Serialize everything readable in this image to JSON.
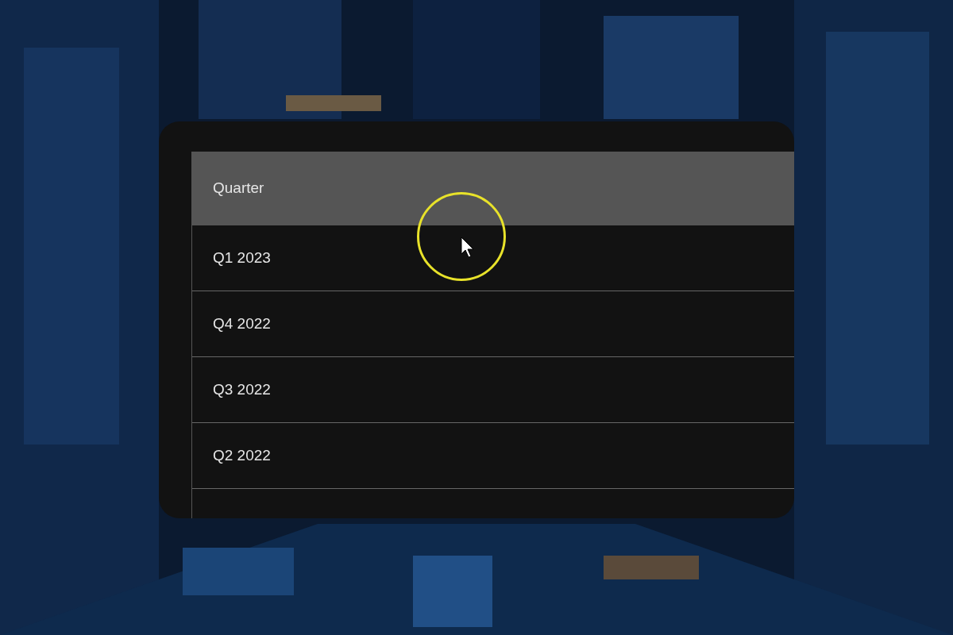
{
  "table": {
    "columns": [
      "Quarter"
    ],
    "rows": [
      {
        "quarter": "Q1 2023"
      },
      {
        "quarter": "Q4 2022"
      },
      {
        "quarter": "Q3 2022"
      },
      {
        "quarter": "Q2 2022"
      }
    ]
  }
}
